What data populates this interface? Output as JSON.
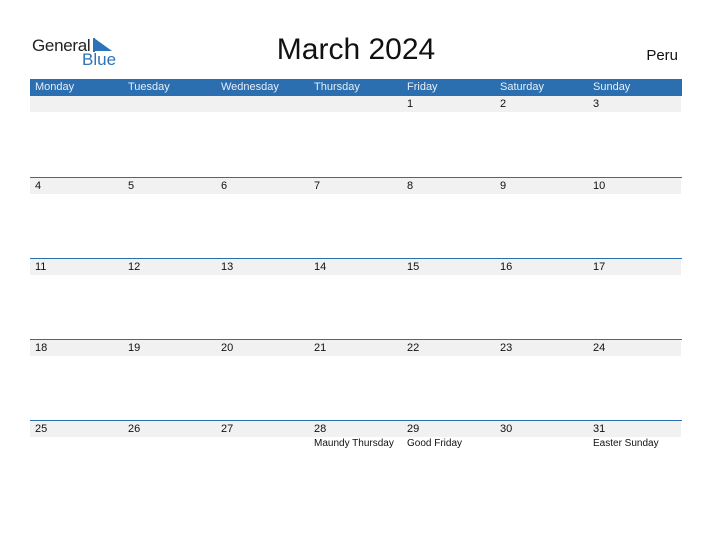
{
  "logo": {
    "general": "General",
    "blue": "Blue",
    "accent": "#2c73b8"
  },
  "title": "March 2024",
  "country": "Peru",
  "weekdays": [
    "Monday",
    "Tuesday",
    "Wednesday",
    "Thursday",
    "Friday",
    "Saturday",
    "Sunday"
  ],
  "weeks": [
    [
      {
        "d": ""
      },
      {
        "d": ""
      },
      {
        "d": ""
      },
      {
        "d": ""
      },
      {
        "d": "1"
      },
      {
        "d": "2"
      },
      {
        "d": "3"
      }
    ],
    [
      {
        "d": "4"
      },
      {
        "d": "5"
      },
      {
        "d": "6"
      },
      {
        "d": "7"
      },
      {
        "d": "8"
      },
      {
        "d": "9"
      },
      {
        "d": "10"
      }
    ],
    [
      {
        "d": "11"
      },
      {
        "d": "12"
      },
      {
        "d": "13"
      },
      {
        "d": "14"
      },
      {
        "d": "15"
      },
      {
        "d": "16"
      },
      {
        "d": "17"
      }
    ],
    [
      {
        "d": "18"
      },
      {
        "d": "19"
      },
      {
        "d": "20"
      },
      {
        "d": "21"
      },
      {
        "d": "22"
      },
      {
        "d": "23"
      },
      {
        "d": "24"
      }
    ],
    [
      {
        "d": "25"
      },
      {
        "d": "26"
      },
      {
        "d": "27"
      },
      {
        "d": "28",
        "e": "Maundy Thursday"
      },
      {
        "d": "29",
        "e": "Good Friday"
      },
      {
        "d": "30"
      },
      {
        "d": "31",
        "e": "Easter Sunday"
      }
    ]
  ]
}
